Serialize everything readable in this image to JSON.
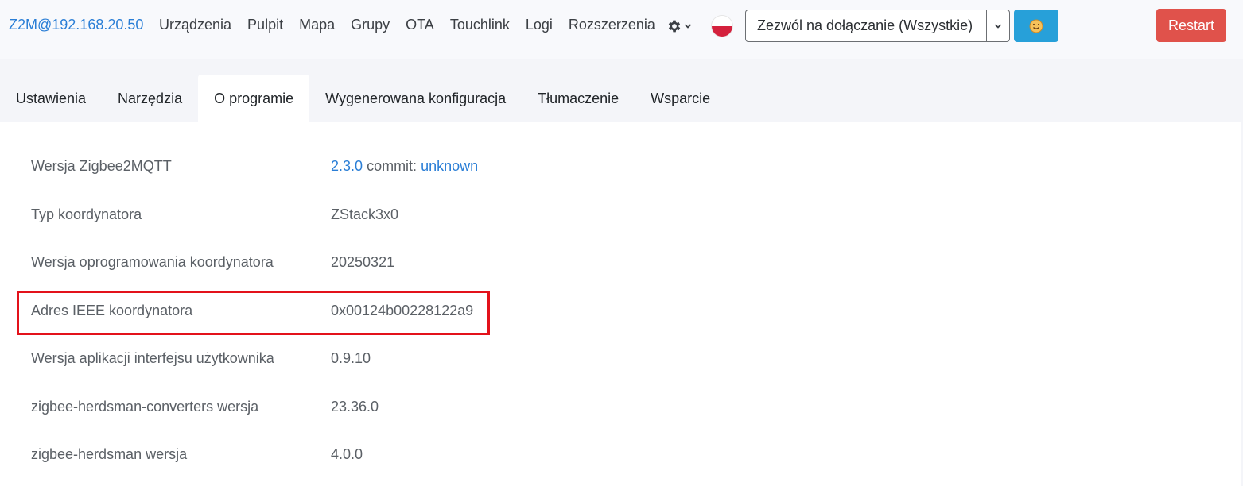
{
  "navbar": {
    "brand": "Z2M@192.168.20.50",
    "links": [
      "Urządzenia",
      "Pulpit",
      "Mapa",
      "Grupy",
      "OTA",
      "Touchlink",
      "Logi",
      "Rozszerzenia"
    ],
    "settings_icon": "gear-icon",
    "language_icon": "poland-flag-icon",
    "permit_join_select": "Zezwól na dołączanie (Wszystkie)",
    "permit_join_icon": "smiley-icon",
    "restart_label": "Restart"
  },
  "tabs": {
    "items": [
      "Ustawienia",
      "Narzędzia",
      "O programie",
      "Wygenerowana konfiguracja",
      "Tłumaczenie",
      "Wsparcie"
    ],
    "active": "O programie"
  },
  "about": {
    "rows": [
      {
        "label": "Wersja Zigbee2MQTT",
        "version": "2.3.0",
        "commit_label": "commit:",
        "commit": "unknown"
      },
      {
        "label": "Typ koordynatora",
        "value": "ZStack3x0"
      },
      {
        "label": "Wersja oprogramowania koordynatora",
        "value": "20250321"
      },
      {
        "label": "Adres IEEE koordynatora",
        "value": "0x00124b00228122a9"
      },
      {
        "label": "Wersja aplikacji interfejsu użytkownika",
        "value": "0.9.10"
      },
      {
        "label": "zigbee-herdsman-converters wersja",
        "value": "23.36.0"
      },
      {
        "label": "zigbee-herdsman wersja",
        "value": "4.0.0"
      }
    ]
  },
  "colors": {
    "brand_link": "#2a7ed6",
    "restart_button": "#e0524b",
    "permit_button": "#27a0d9",
    "highlight_border": "#e3121b"
  }
}
